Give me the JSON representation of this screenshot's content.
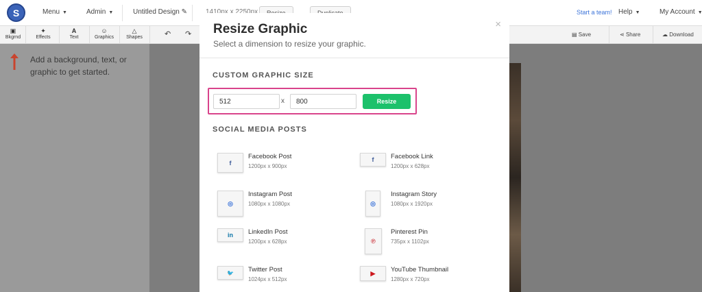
{
  "topbar": {
    "logo_letter": "S",
    "menu_label": "Menu",
    "admin_label": "Admin",
    "design_title": "Untitled Design",
    "dimensions": "1410px x 2250px",
    "resize_label": "Resize",
    "duplicate_label": "Duplicate",
    "start_team": "Start a team!",
    "help_label": "Help",
    "account_label": "My Account"
  },
  "toolbar": {
    "tools": [
      "Bkgrnd",
      "Effects",
      "Text",
      "Graphics",
      "Shapes"
    ],
    "save_label": "Save",
    "share_label": "Share",
    "download_label": "Download"
  },
  "left_panel": {
    "hint": "Add a background, text, or graphic to get started."
  },
  "modal": {
    "title": "Resize Graphic",
    "subtitle": "Select a dimension to resize your graphic.",
    "close_glyph": "×",
    "custom_title": "CUSTOM GRAPHIC SIZE",
    "width_value": "512",
    "height_value": "800",
    "times": "x",
    "resize_button": "Resize",
    "social_title": "SOCIAL MEDIA POSTS",
    "posts": [
      {
        "name": "Facebook Post",
        "size": "1200px x 900px",
        "icon": "f",
        "color": "#3b5998"
      },
      {
        "name": "Facebook Link",
        "size": "1200px x 628px",
        "icon": "f",
        "color": "#3b5998"
      },
      {
        "name": "Instagram Post",
        "size": "1080px x 1080px",
        "icon": "◎",
        "color": "#3b73d9"
      },
      {
        "name": "Instagram Story",
        "size": "1080px x 1920px",
        "icon": "◎",
        "color": "#3b73d9"
      },
      {
        "name": "LinkedIn Post",
        "size": "1200px x 628px",
        "icon": "in",
        "color": "#0e76a8"
      },
      {
        "name": "Pinterest Pin",
        "size": "735px x 1102px",
        "icon": "℗",
        "color": "#c8232c"
      },
      {
        "name": "Twitter Post",
        "size": "1024px x 512px",
        "icon": "🐦",
        "color": "#1da1f2"
      },
      {
        "name": "YouTube Thumbnail",
        "size": "1280px x 720px",
        "icon": "▶",
        "color": "#cc181e"
      }
    ]
  }
}
